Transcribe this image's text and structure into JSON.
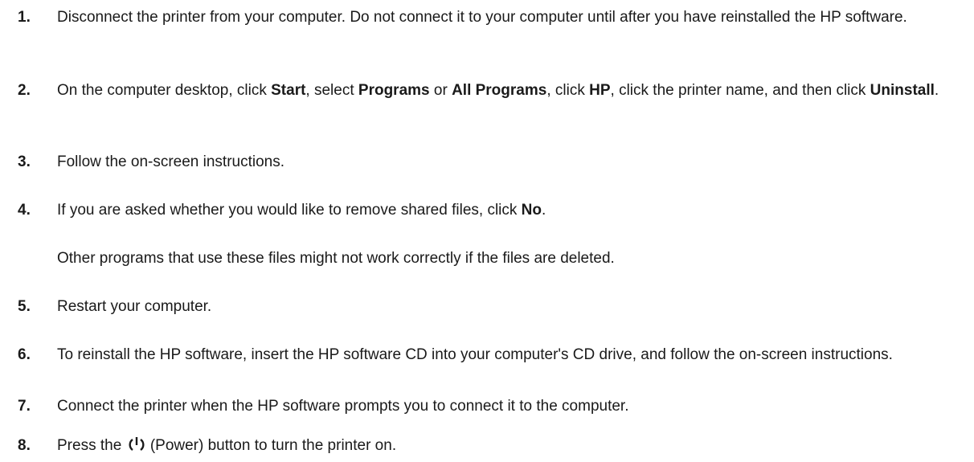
{
  "steps": [
    {
      "number": "1.",
      "parts": [
        {
          "t": "Disconnect the printer from your computer. Do not connect it to your computer until after you have reinstalled the HP software."
        }
      ]
    },
    {
      "number": "2.",
      "parts": [
        {
          "t": "On the computer desktop, click "
        },
        {
          "t": "Start",
          "b": true
        },
        {
          "t": ", select "
        },
        {
          "t": "Programs",
          "b": true
        },
        {
          "t": " or "
        },
        {
          "t": "All Programs",
          "b": true
        },
        {
          "t": ", click "
        },
        {
          "t": "HP",
          "b": true
        },
        {
          "t": ", click the printer name, and then click "
        },
        {
          "t": "Uninstall",
          "b": true
        },
        {
          "t": "."
        }
      ]
    },
    {
      "number": "3.",
      "parts": [
        {
          "t": "Follow the on-screen instructions."
        }
      ]
    },
    {
      "number": "4.",
      "parts": [
        {
          "t": "If you are asked whether you would like to remove shared files, click "
        },
        {
          "t": "No",
          "b": true
        },
        {
          "t": "."
        }
      ]
    },
    {
      "number": "5.",
      "parts": [
        {
          "t": "Restart your computer."
        }
      ]
    },
    {
      "number": "6.",
      "parts": [
        {
          "t": "To reinstall the HP software, insert the HP software CD into your computer's CD drive, and follow the on-screen instructions."
        }
      ]
    },
    {
      "number": "7.",
      "parts": [
        {
          "t": "Connect the printer when the HP software prompts you to connect it to the computer."
        }
      ]
    },
    {
      "number": "8.",
      "parts": [
        {
          "t": "Press the "
        },
        {
          "icon": "power-icon"
        },
        {
          "t": " (Power) button to turn the printer on."
        }
      ]
    }
  ],
  "note_step4": "Other programs that use these files might not work correctly if the files are deleted."
}
